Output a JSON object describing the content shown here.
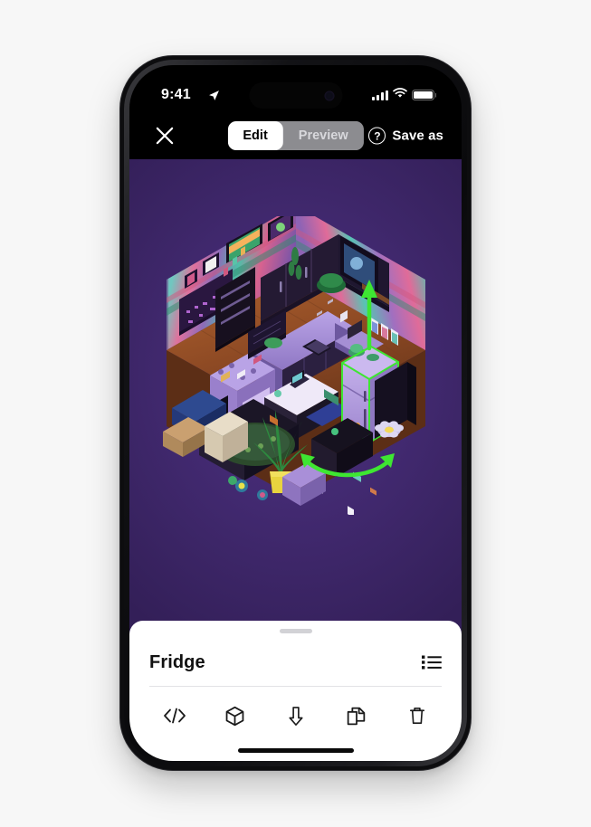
{
  "status_bar": {
    "time": "9:41",
    "location_icon": "location-arrow-icon",
    "cellular_icon": "cellular-signal-icon",
    "wifi_icon": "wifi-icon",
    "battery_icon": "battery-full-icon"
  },
  "toolbar": {
    "close_icon": "close-x-icon",
    "segments": [
      {
        "label": "Edit",
        "selected": true
      },
      {
        "label": "Preview",
        "selected": false
      }
    ],
    "help_icon": "question-mark-circle-icon",
    "help_glyph": "?",
    "save_as_label": "Save as"
  },
  "canvas": {
    "background_color": "#432a72",
    "scene_name": "isometric-pixel-art-kitchen-room",
    "selection": {
      "object_label": "Fridge",
      "outline_color": "#3ee632",
      "move_handle_icon": "vertical-move-arrow-icon",
      "rotate_handle_icon": "rotate-arrow-icon"
    },
    "tools_left": [
      {
        "name": "add-object-button",
        "icon": "plus-icon"
      },
      {
        "name": "media-library-button",
        "icon": "media-stack-icon"
      }
    ],
    "tools_right": [
      {
        "name": "undo-button",
        "icon": "undo-arrow-icon",
        "enabled": true
      },
      {
        "name": "redo-button",
        "icon": "redo-arrow-icon",
        "enabled": false
      }
    ]
  },
  "sheet": {
    "handle_icon": "drag-handle-icon",
    "title": "Fridge",
    "list_icon": "bulleted-list-icon",
    "actions": [
      {
        "name": "code-button",
        "icon": "code-brackets-icon",
        "label": "</>"
      },
      {
        "name": "model-button",
        "icon": "cube-3d-icon"
      },
      {
        "name": "download-button",
        "icon": "download-arrow-icon"
      },
      {
        "name": "duplicate-button",
        "icon": "duplicate-pages-icon"
      },
      {
        "name": "delete-button",
        "icon": "trash-can-icon"
      }
    ],
    "home_indicator": "home-indicator-bar"
  },
  "colors": {
    "page_background": "#f7f7f7",
    "device_body": "#0d0d0f",
    "selection_green": "#3ee632",
    "accent_purple": "#432a72"
  }
}
